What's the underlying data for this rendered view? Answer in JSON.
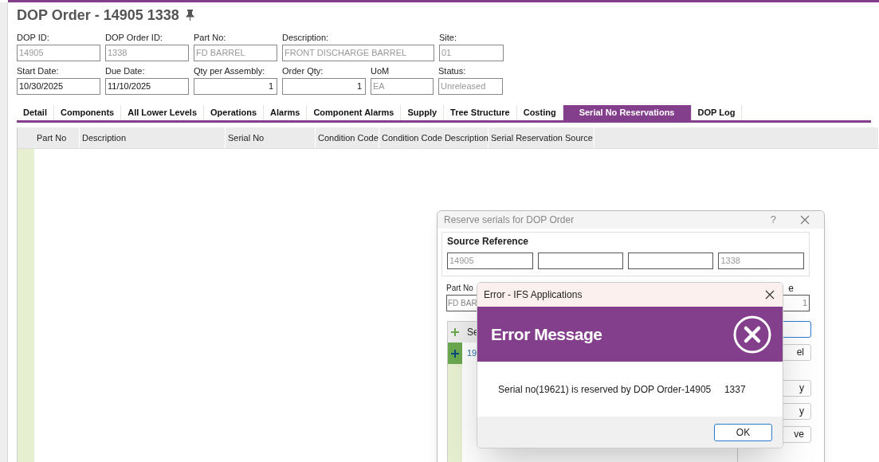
{
  "page": {
    "title": "DOP Order - 14905 1338"
  },
  "header_rows": [
    [
      {
        "label": "DOP ID:",
        "value": "14905",
        "readonly": true,
        "kind": "text"
      },
      {
        "label": "DOP Order ID:",
        "value": "1338",
        "readonly": true,
        "kind": "text"
      },
      {
        "label": "Part No:",
        "value": "FD BARREL",
        "readonly": true,
        "kind": "text"
      },
      {
        "label": "Description:",
        "value": "FRONT DISCHARGE BARREL",
        "readonly": true,
        "kind": "text"
      },
      {
        "label": "Site:",
        "value": "01",
        "readonly": true,
        "kind": "text"
      }
    ],
    [
      {
        "label": "Start Date:",
        "value": "10/30/2025",
        "readonly": false,
        "kind": "text"
      },
      {
        "label": "Due Date:",
        "value": "11/10/2025",
        "readonly": false,
        "kind": "text"
      },
      {
        "label": "Qty per Assembly:",
        "value": "1",
        "readonly": false,
        "kind": "number"
      },
      {
        "label": "Order Qty:",
        "value": "1",
        "readonly": false,
        "kind": "number"
      },
      {
        "label": "UoM",
        "value": "EA",
        "readonly": true,
        "kind": "text"
      },
      {
        "label": "Status:",
        "value": "Unreleased",
        "readonly": true,
        "kind": "text"
      }
    ]
  ],
  "tabs": [
    {
      "label": "Detail",
      "selected": false
    },
    {
      "label": "Components",
      "selected": false
    },
    {
      "label": "All Lower Levels",
      "selected": false
    },
    {
      "label": "Operations",
      "selected": false
    },
    {
      "label": "Alarms",
      "selected": false
    },
    {
      "label": "Component Alarms",
      "selected": false
    },
    {
      "label": "Supply",
      "selected": false
    },
    {
      "label": "Tree Structure",
      "selected": false
    },
    {
      "label": "Costing",
      "selected": false
    },
    {
      "label": "Serial No Reservations",
      "selected": true
    },
    {
      "label": "DOP Log",
      "selected": false
    }
  ],
  "table": {
    "columns": [
      "Part No",
      "Description",
      "Serial No",
      "Condition Code",
      "Condition Code Description",
      "Serial Reservation Source"
    ]
  },
  "reserve_dialog": {
    "title": "Reserve serials for DOP Order",
    "help": "?",
    "source_reference": {
      "legend": "Source Reference",
      "field_1": "14905",
      "field_4": "1338"
    },
    "part_no_label": "Part No",
    "part_no_value": "FD BAR",
    "qty_label": "e",
    "qty_value": "1",
    "grid_header": "Se",
    "grid_row": "19",
    "buttons": [
      {
        "focused": true
      },
      {
        "label": "el",
        "focused": false
      },
      {
        "label": "y",
        "focused": false
      },
      {
        "label": "y",
        "focused": false
      },
      {
        "label": "ve",
        "focused": false
      }
    ]
  },
  "error_dialog": {
    "title": "Error - IFS Applications",
    "heading": "Error Message",
    "message": "Serial no(19621) is reserved by DOP Order-14905     1337",
    "button": "OK"
  }
}
